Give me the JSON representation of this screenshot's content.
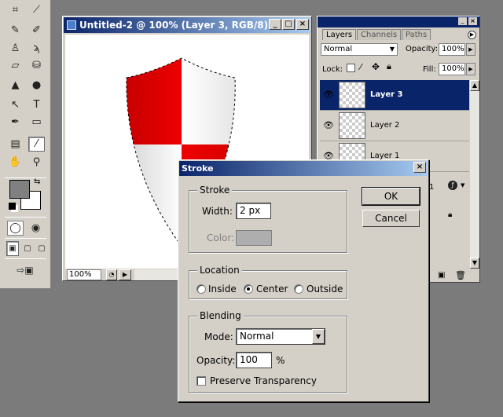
{
  "toolbox": {
    "tools": [
      {
        "icon": "crop-icon",
        "glyph": "⌗"
      },
      {
        "icon": "slice-icon",
        "glyph": "⟋"
      },
      {
        "icon": "healing-brush-icon",
        "glyph": "✎"
      },
      {
        "icon": "brush-icon",
        "glyph": "✐"
      },
      {
        "icon": "clone-stamp-icon",
        "glyph": "♙"
      },
      {
        "icon": "history-brush-icon",
        "glyph": "ϡ"
      },
      {
        "icon": "eraser-icon",
        "glyph": "▱"
      },
      {
        "icon": "paint-bucket-icon",
        "glyph": "⛁"
      },
      {
        "icon": "blur-icon",
        "glyph": "▲"
      },
      {
        "icon": "dodge-icon",
        "glyph": "●"
      },
      {
        "icon": "path-selection-icon",
        "glyph": "↖"
      },
      {
        "icon": "type-icon",
        "glyph": "T"
      },
      {
        "icon": "pen-icon",
        "glyph": "✒"
      },
      {
        "icon": "rectangle-icon",
        "glyph": "▭"
      },
      {
        "icon": "notes-icon",
        "glyph": "▤"
      },
      {
        "icon": "eyedropper-icon",
        "glyph": "⁄"
      },
      {
        "icon": "hand-icon",
        "glyph": "✋"
      },
      {
        "icon": "zoom-icon",
        "glyph": "⚲"
      }
    ],
    "foreground_color": "#808080",
    "background_color": "#ffffff"
  },
  "document": {
    "title": "Untitled-2 @ 100% (Layer 3, RGB/8)",
    "zoom": "100%",
    "shield_red": "#ee0000",
    "shield_white": "#ffffff"
  },
  "layers_palette": {
    "tabs": [
      "Layers",
      "Channels",
      "Paths"
    ],
    "blend_mode": "Normal",
    "opacity_label": "Opacity:",
    "opacity": "100%",
    "lock_label": "Lock:",
    "fill_label": "Fill:",
    "fill": "100%",
    "layers": [
      {
        "name": "Layer 3",
        "selected": true
      },
      {
        "name": "Layer 2",
        "selected": false
      },
      {
        "name": "Layer 1",
        "selected": false
      }
    ],
    "partial_text": "1"
  },
  "stroke_dialog": {
    "title": "Stroke",
    "stroke_group": "Stroke",
    "width_label": "Width:",
    "width_value": "2 px",
    "color_label": "Color:",
    "stroke_color": "#aeaeae",
    "location_group": "Location",
    "location_options": [
      "Inside",
      "Center",
      "Outside"
    ],
    "location_selected": "Center",
    "blending_group": "Blending",
    "mode_label": "Mode:",
    "mode_value": "Normal",
    "opacity_label": "Opacity:",
    "opacity_value": "100",
    "opacity_unit": "%",
    "preserve_label": "Preserve Transparency",
    "preserve_checked": false,
    "ok_label": "OK",
    "cancel_label": "Cancel"
  }
}
